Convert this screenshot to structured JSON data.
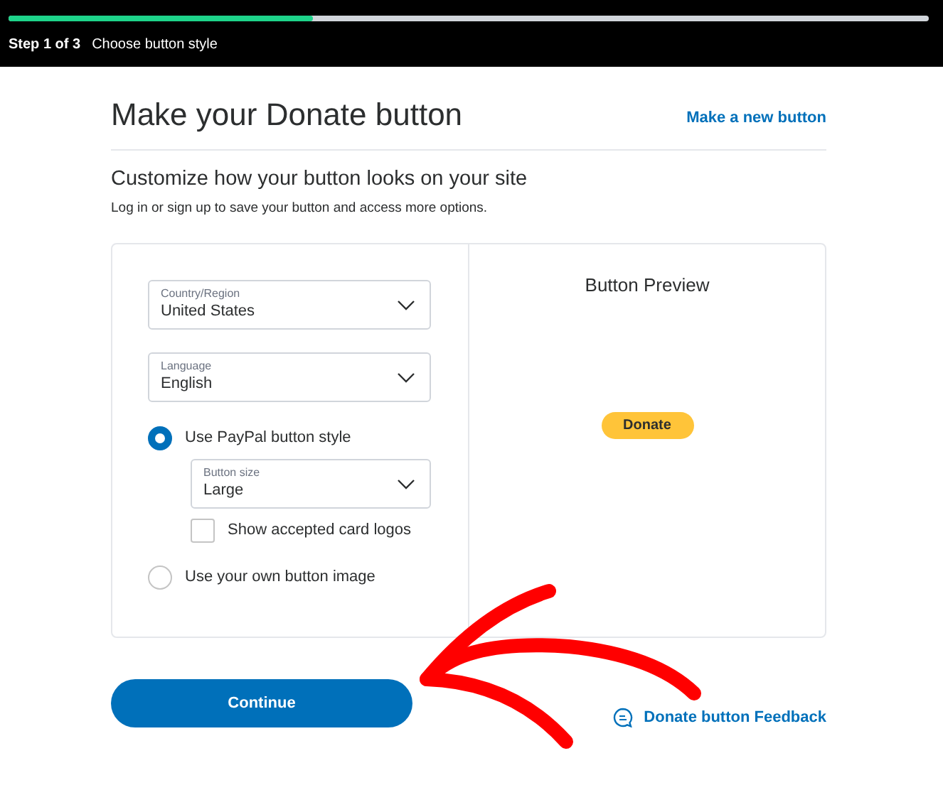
{
  "header": {
    "progress": {
      "level": 0.33
    },
    "step": "Step 1 of 3",
    "step_title": "Choose button style"
  },
  "title": "Make your Donate button",
  "new_button_link": "Make a new button",
  "subtitle": "Customize how your button looks on your site",
  "note": "Log in or sign up to save your button and access more options.",
  "form": {
    "country": {
      "label": "Country/Region",
      "value": "United States"
    },
    "language": {
      "label": "Language",
      "value": "English"
    },
    "options": [
      {
        "label": "Use PayPal button style",
        "selected": true
      },
      {
        "label": "Use your own button image",
        "selected": false
      }
    ],
    "button_size": {
      "label": "Button size",
      "value": "Large"
    },
    "card_logos": {
      "label": "Show accepted card logos",
      "checked": false
    }
  },
  "preview": {
    "title": "Button Preview",
    "button": "Donate"
  },
  "continue": "Continue",
  "feedback_link": "Donate button Feedback"
}
